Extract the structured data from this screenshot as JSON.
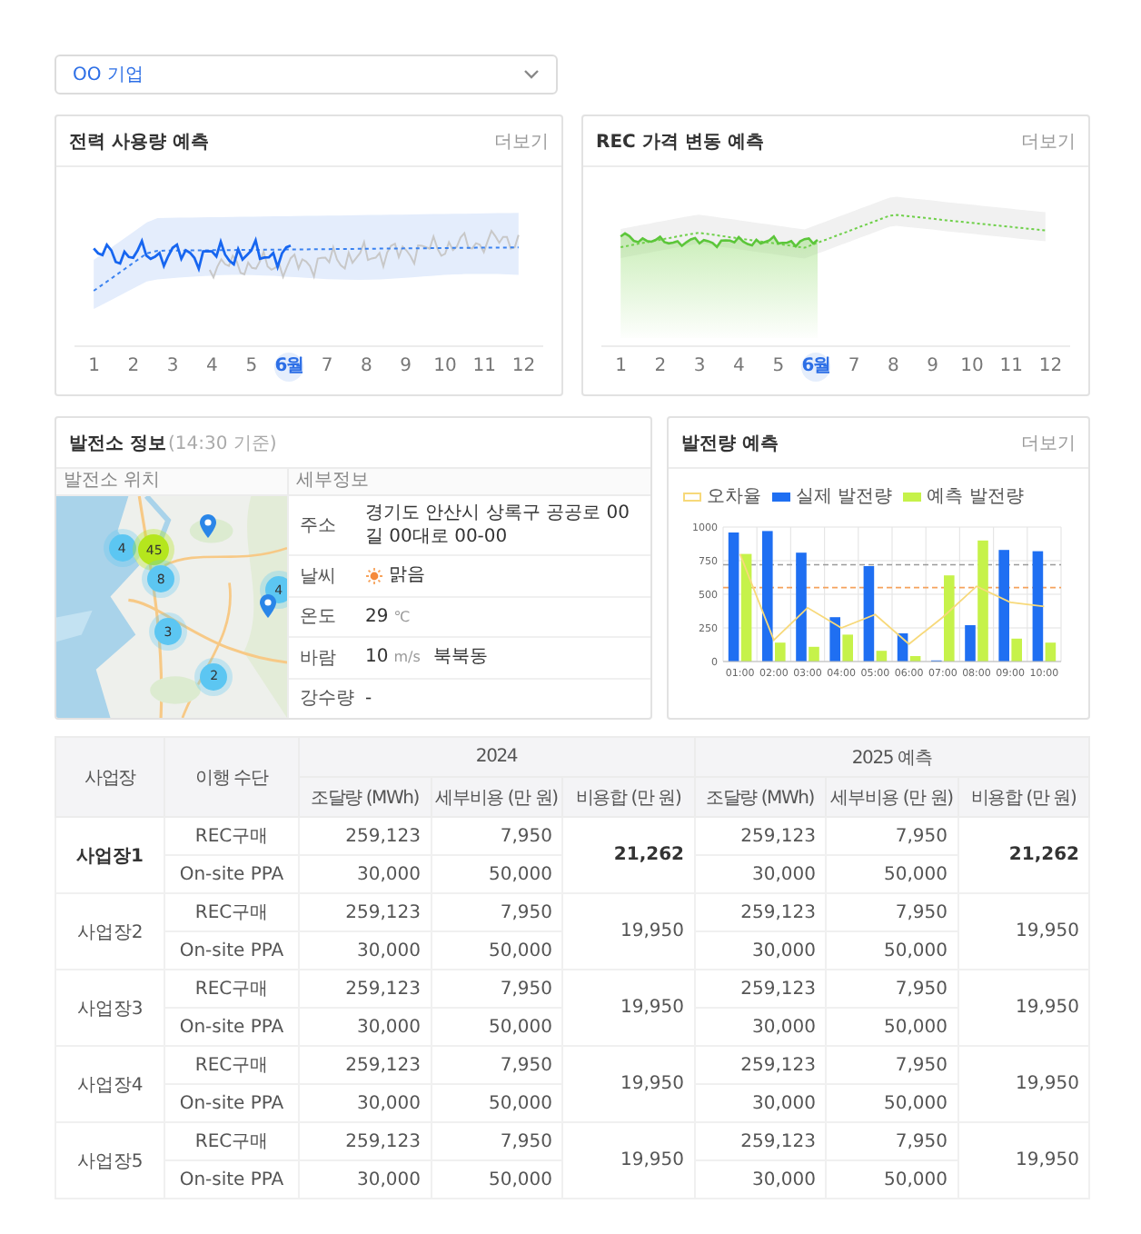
{
  "company_select": {
    "value": "OO 기업"
  },
  "usage_forecast": {
    "title": "전력 사용량 예측",
    "more": "더보기",
    "months": [
      {
        "label": "1",
        "selected": false
      },
      {
        "label": "2",
        "selected": false
      },
      {
        "label": "3",
        "selected": false
      },
      {
        "label": "4",
        "selected": false
      },
      {
        "label": "5",
        "selected": false
      },
      {
        "label": "6월",
        "selected": true
      },
      {
        "label": "7",
        "selected": false
      },
      {
        "label": "8",
        "selected": false
      },
      {
        "label": "9",
        "selected": false
      },
      {
        "label": "10",
        "selected": false
      },
      {
        "label": "11",
        "selected": false
      },
      {
        "label": "12",
        "selected": false
      }
    ]
  },
  "rec_forecast": {
    "title": "REC 가격 변동 예측",
    "more": "더보기",
    "months": [
      {
        "label": "1",
        "selected": false
      },
      {
        "label": "2",
        "selected": false
      },
      {
        "label": "3",
        "selected": false
      },
      {
        "label": "4",
        "selected": false
      },
      {
        "label": "5",
        "selected": false
      },
      {
        "label": "6월",
        "selected": true
      },
      {
        "label": "7",
        "selected": false
      },
      {
        "label": "8",
        "selected": false
      },
      {
        "label": "9",
        "selected": false
      },
      {
        "label": "10",
        "selected": false
      },
      {
        "label": "11",
        "selected": false
      },
      {
        "label": "12",
        "selected": false
      }
    ]
  },
  "plant_info": {
    "title": "발전소 정보",
    "timestamp": "(14:30 기준)",
    "map_header": "발전소 위치",
    "detail_header": "세부정보",
    "clusters": [
      {
        "count": "4",
        "color": "#5cc6f2"
      },
      {
        "count": "45",
        "color": "#b5e61d"
      },
      {
        "count": "8",
        "color": "#5cc6f2"
      },
      {
        "count": "4",
        "color": "#5cc6f2"
      },
      {
        "count": "3",
        "color": "#5cc6f2"
      },
      {
        "count": "2",
        "color": "#5cc6f2"
      }
    ],
    "details": [
      {
        "kind": "text",
        "label": "주소",
        "value": "경기도 안산시 상록구 공공로 00길 00대로 00-00"
      },
      {
        "kind": "weather",
        "label": "날씨",
        "value": "맑음"
      },
      {
        "kind": "measure",
        "label": "온도",
        "value": "29",
        "unit": "℃"
      },
      {
        "kind": "measure",
        "label": "바람",
        "value": "10",
        "unit": "m/s",
        "extra": "북북동"
      },
      {
        "kind": "text",
        "label": "강수량",
        "value": "-"
      }
    ]
  },
  "generation_forecast": {
    "title": "발전량 예측",
    "more": "더보기",
    "chart_data": {
      "type": "bar",
      "categories": [
        "01:00",
        "02:00",
        "03:00",
        "04:00",
        "05:00",
        "06:00",
        "07:00",
        "08:00",
        "09:00",
        "10:00"
      ],
      "series": [
        {
          "name": "오차율",
          "type": "line",
          "color": "#f7d97a",
          "values": [
            800,
            160,
            400,
            250,
            350,
            130,
            330,
            560,
            440,
            410
          ]
        },
        {
          "name": "실제 발전량",
          "type": "bar",
          "color": "#1f6ff2",
          "values": [
            960,
            970,
            810,
            330,
            710,
            210,
            0,
            270,
            830,
            820
          ]
        },
        {
          "name": "예측 발전량",
          "type": "bar",
          "color": "#c6f24a",
          "values": [
            800,
            140,
            110,
            200,
            80,
            40,
            640,
            900,
            170,
            140
          ]
        }
      ],
      "ylim": [
        0,
        1000
      ],
      "yticks": [
        0,
        250,
        500,
        750,
        1000
      ],
      "stacked": false,
      "grid": true,
      "ref_lines": [
        {
          "axis": "y",
          "value": 720,
          "color": "#9a9a9a"
        },
        {
          "axis": "y",
          "value": 550,
          "color": "#f5a25d"
        }
      ]
    }
  },
  "table": {
    "top_headers": [
      "사업장",
      "이행 수단"
    ],
    "year_headers": [
      "2024",
      "2025 예측"
    ],
    "sub_headers": [
      "조달량 (MWh)",
      "세부비용 (만 원)",
      "비용합 (만 원)",
      "조달량 (MWh)",
      "세부비용 (만 원)",
      "비용합 (만 원)"
    ],
    "rows": [
      {
        "site": "사업장1",
        "highlighted": true,
        "totals": [
          "21,262",
          "21,262"
        ],
        "methods": [
          {
            "name": "REC구매",
            "years": [
              {
                "amount": "259,123",
                "cost": "7,950"
              },
              {
                "amount": "259,123",
                "cost": "7,950"
              }
            ]
          },
          {
            "name": "On-site PPA",
            "years": [
              {
                "amount": "30,000",
                "cost": "50,000"
              },
              {
                "amount": "30,000",
                "cost": "50,000"
              }
            ]
          }
        ]
      },
      {
        "site": "사업장2",
        "highlighted": false,
        "totals": [
          "19,950",
          "19,950"
        ],
        "methods": [
          {
            "name": "REC구매",
            "years": [
              {
                "amount": "259,123",
                "cost": "7,950"
              },
              {
                "amount": "259,123",
                "cost": "7,950"
              }
            ]
          },
          {
            "name": "On-site PPA",
            "years": [
              {
                "amount": "30,000",
                "cost": "50,000"
              },
              {
                "amount": "30,000",
                "cost": "50,000"
              }
            ]
          }
        ]
      },
      {
        "site": "사업장3",
        "highlighted": false,
        "totals": [
          "19,950",
          "19,950"
        ],
        "methods": [
          {
            "name": "REC구매",
            "years": [
              {
                "amount": "259,123",
                "cost": "7,950"
              },
              {
                "amount": "259,123",
                "cost": "7,950"
              }
            ]
          },
          {
            "name": "On-site PPA",
            "years": [
              {
                "amount": "30,000",
                "cost": "50,000"
              },
              {
                "amount": "30,000",
                "cost": "50,000"
              }
            ]
          }
        ]
      },
      {
        "site": "사업장4",
        "highlighted": false,
        "totals": [
          "19,950",
          "19,950"
        ],
        "methods": [
          {
            "name": "REC구매",
            "years": [
              {
                "amount": "259,123",
                "cost": "7,950"
              },
              {
                "amount": "259,123",
                "cost": "7,950"
              }
            ]
          },
          {
            "name": "On-site PPA",
            "years": [
              {
                "amount": "30,000",
                "cost": "50,000"
              },
              {
                "amount": "30,000",
                "cost": "50,000"
              }
            ]
          }
        ]
      },
      {
        "site": "사업장5",
        "highlighted": false,
        "totals": [
          "19,950",
          "19,950"
        ],
        "methods": [
          {
            "name": "REC구매",
            "years": [
              {
                "amount": "259,123",
                "cost": "7,950"
              },
              {
                "amount": "259,123",
                "cost": "7,950"
              }
            ]
          },
          {
            "name": "On-site PPA",
            "years": [
              {
                "amount": "30,000",
                "cost": "50,000"
              },
              {
                "amount": "30,000",
                "cost": "50,000"
              }
            ]
          }
        ]
      }
    ]
  }
}
